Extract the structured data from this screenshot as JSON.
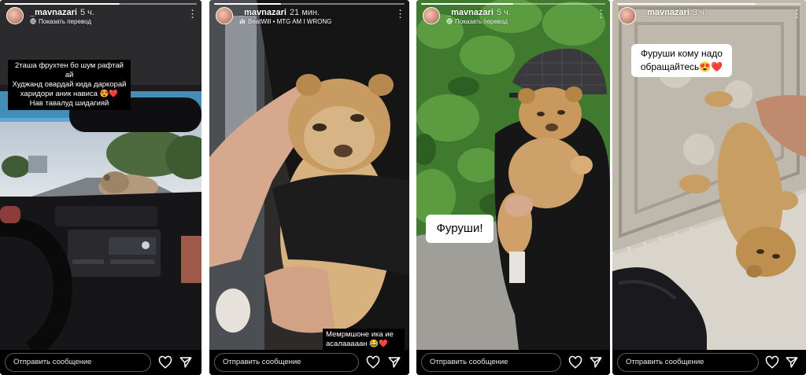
{
  "stories": [
    {
      "username": "_mavnazari",
      "time": "5 ч.",
      "subline": "Показать перевод",
      "caption_lines": [
        "2таша фрухтен бо шум рафтай ай",
        "Худжанд овардай кида даркорай",
        "харидори аник нависа 😍❤️",
        "Нав тавалуд шидагияй"
      ],
      "reply_placeholder": "Отправить сообщение",
      "progress": 0.6
    },
    {
      "username": "_mavnazari",
      "time": "21 мин.",
      "subline": "BeatWill • MTG AM I WRONG",
      "caption_lines": [
        "Мемрмшоне ика ие",
        "асалааааан 😂❤️"
      ],
      "reply_placeholder": "Отправить сообщение",
      "progress": 0.35
    },
    {
      "username": "_mavnazari",
      "time": "5 ч.",
      "subline": "Показать перевод",
      "caption_lines": [
        "Фуруши!"
      ],
      "reply_placeholder": "Отправить сообщение",
      "progress": 0.5
    },
    {
      "username": "_mavnazari",
      "time": "3 ч.",
      "subline": "",
      "caption_lines": [
        "Фуруши кому надо",
        "обращайтесь😍❤️"
      ],
      "reply_placeholder": "Отправить сообщение",
      "progress": 0.75
    }
  ]
}
